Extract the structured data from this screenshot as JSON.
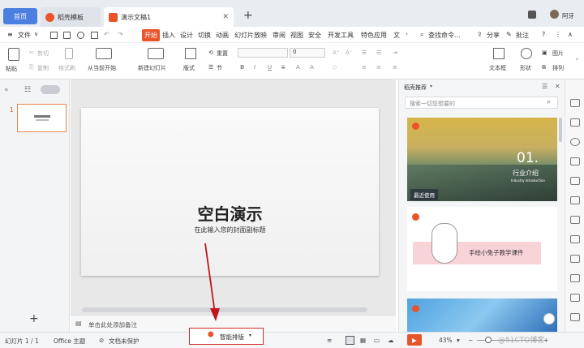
{
  "tabs": {
    "home": "首页",
    "daoke": "稻壳模板",
    "doc": "演示文稿1",
    "new_tab": "+",
    "user": "阿牙"
  },
  "menu": {
    "file": "文件",
    "items": [
      "开始",
      "插入",
      "设计",
      "切换",
      "动画",
      "幻灯片放映",
      "审阅",
      "视图",
      "安全",
      "开发工具",
      "特色应用",
      "文"
    ],
    "search": "查找命令...",
    "share": "分享",
    "annotate": "批注",
    "help": "?"
  },
  "ribbon": {
    "paste": "粘贴",
    "cut": "剪切",
    "copy": "复制",
    "format_painter": "格式刷",
    "from_current": "从当前开始",
    "new_slide": "新建幻灯片",
    "layout": "版式",
    "section": "节",
    "reset": "重置",
    "font_size": "0",
    "text_box": "文本框",
    "shape": "形状",
    "image": "图片",
    "arrange": "排列",
    "bold": "B",
    "italic": "I",
    "underline": "U",
    "strike": "S"
  },
  "slide_panel": {
    "number": "1",
    "add": "+"
  },
  "slide": {
    "title": "空白演示",
    "subtitle": "在此输入您的封面副标题"
  },
  "notes": {
    "placeholder": "单击此处添加备注"
  },
  "right_panel": {
    "title": "稻壳推荐",
    "search_placeholder": "搜索一切您想要的",
    "cards": [
      {
        "number": "01.",
        "heading": "行业介绍",
        "sub": "Industry Introduction",
        "badge": "最近使用"
      },
      {
        "title": "手绘小兔子教学课件"
      },
      {
        "title": ""
      }
    ]
  },
  "status": {
    "slide_count": "幻灯片 1 / 1",
    "theme": "Office 主题",
    "protect": "文档未保护",
    "smart": "智能排版",
    "zoom": "43%",
    "watermark": "@51CTO博客"
  },
  "colors": {
    "accent": "#e9542b",
    "home_tab": "#4b7fe0",
    "arrow": "#c0161c"
  }
}
